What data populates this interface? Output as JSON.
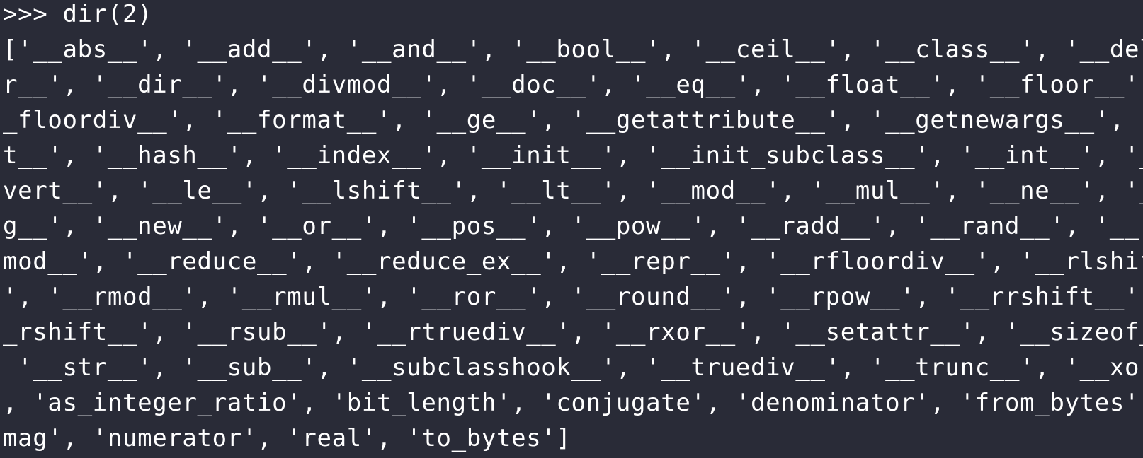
{
  "terminal": {
    "background": "#292b37",
    "foreground": "#ffffff",
    "lines": [
      ">>> dir(2)",
      "['__abs__', '__add__', '__and__', '__bool__', '__ceil__', '__class__', '__delatt",
      "r__', '__dir__', '__divmod__', '__doc__', '__eq__', '__float__', '__floor__', '_",
      "_floordiv__', '__format__', '__ge__', '__getattribute__', '__getnewargs__', '__g",
      "t__', '__hash__', '__index__', '__init__', '__init_subclass__', '__int__', '__in",
      "vert__', '__le__', '__lshift__', '__lt__', '__mod__', '__mul__', '__ne__', '__ne",
      "g__', '__new__', '__or__', '__pos__', '__pow__', '__radd__', '__rand__', '__rdiv",
      "mod__', '__reduce__', '__reduce_ex__', '__repr__', '__rfloordiv__', '__rlshift__",
      "', '__rmod__', '__rmul__', '__ror__', '__round__', '__rpow__', '__rrshift__', '_",
      "_rshift__', '__rsub__', '__rtruediv__', '__rxor__', '__setattr__', '__sizeof__',",
      " '__str__', '__sub__', '__subclasshook__', '__truediv__', '__trunc__', '__xor__'",
      ", 'as_integer_ratio', 'bit_length', 'conjugate', 'denominator', 'from_bytes', 'i",
      "mag', 'numerator', 'real', 'to_bytes']"
    ]
  }
}
